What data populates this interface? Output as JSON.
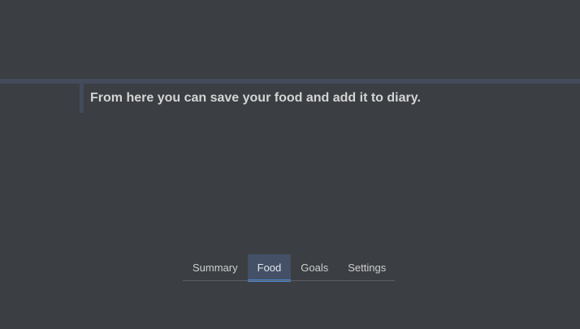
{
  "callout": {
    "text": "From here you can save your food and add it to diary."
  },
  "tabs": [
    {
      "label": "Summary",
      "active": false
    },
    {
      "label": "Food",
      "active": true
    },
    {
      "label": "Goals",
      "active": false
    },
    {
      "label": "Settings",
      "active": false
    }
  ],
  "colors": {
    "background": "#3b3e42",
    "accent_bar": "#434b5c",
    "active_tab": "#445066",
    "active_indicator": "#4a86d0"
  }
}
